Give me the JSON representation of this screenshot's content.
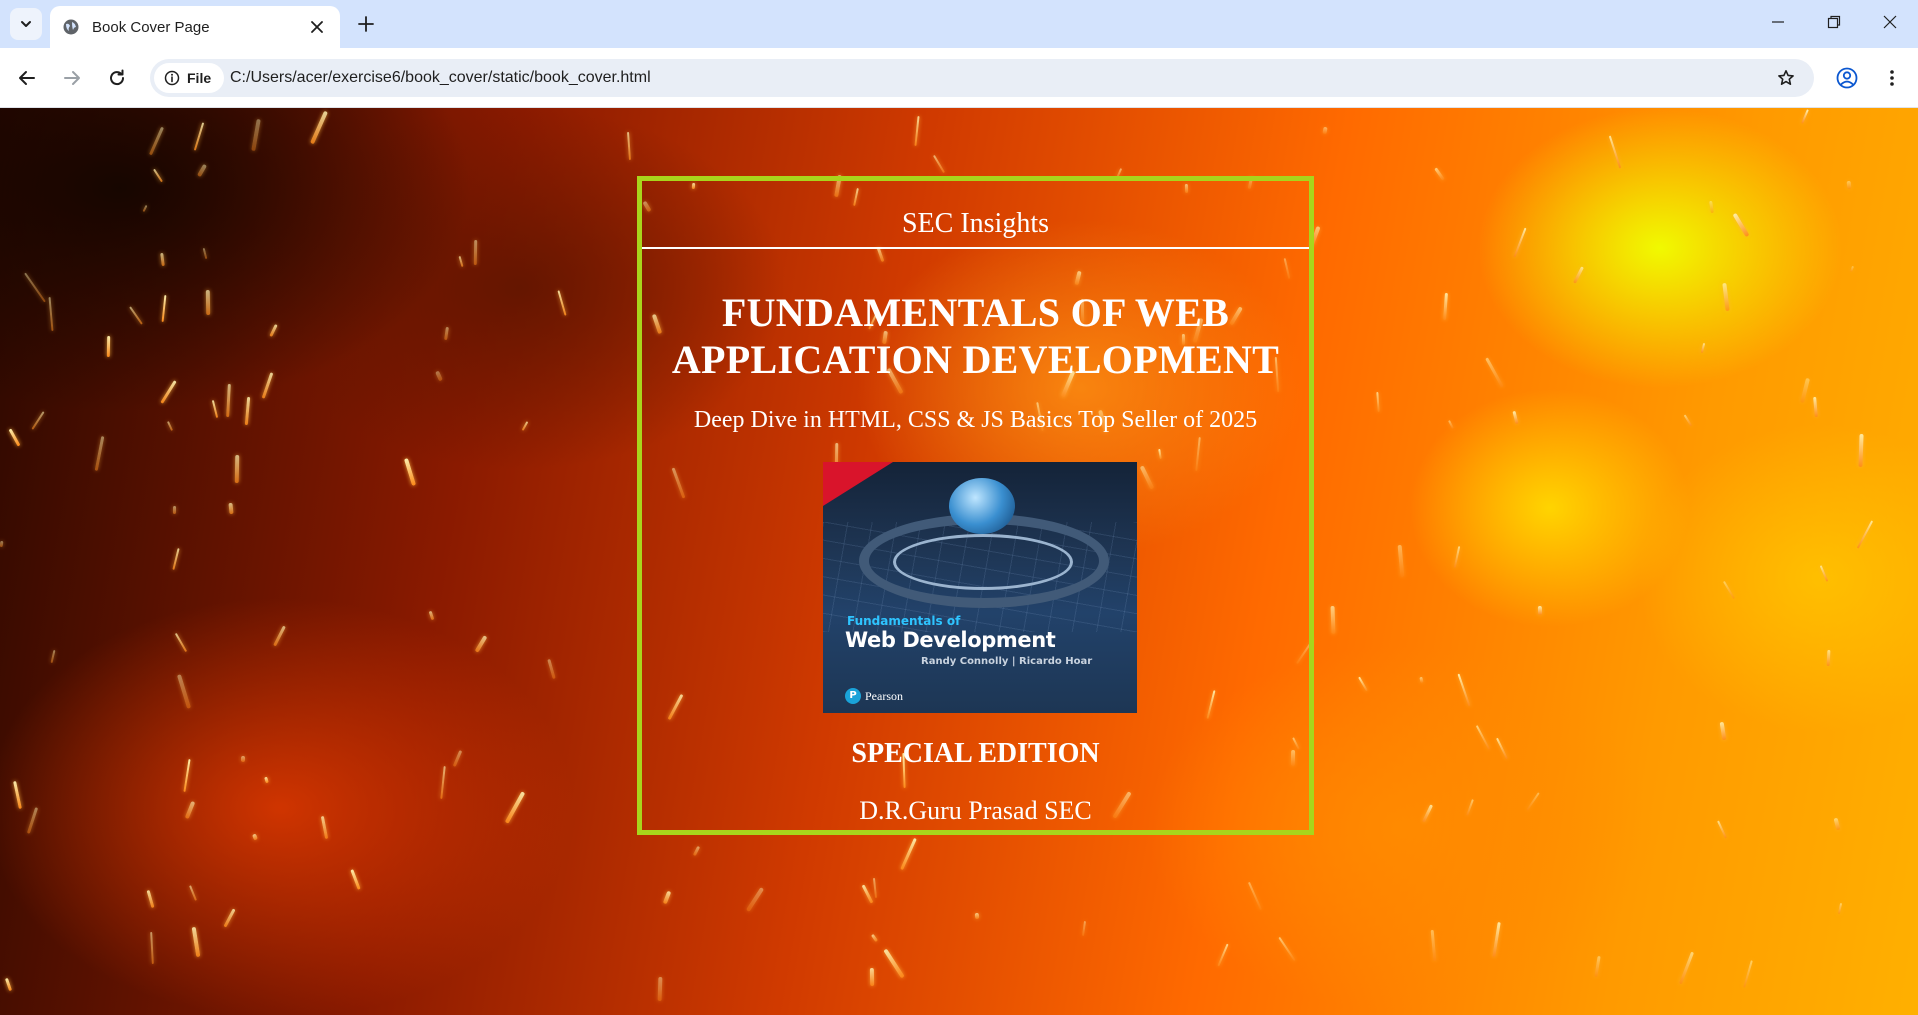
{
  "browser": {
    "tab": {
      "title": "Book Cover Page"
    },
    "address_bar": {
      "site_chip_label": "File",
      "url": "C:/Users/acer/exercise6/book_cover/static/book_cover.html"
    },
    "icons": {
      "tab_search": "chevron-down-icon",
      "favicon": "globe-icon",
      "tab_close": "close-icon",
      "new_tab": "plus-icon",
      "back": "arrow-left-icon",
      "forward": "arrow-right-icon",
      "reload": "reload-icon",
      "site_info": "info-icon",
      "bookmark": "star-icon",
      "profile": "profile-icon",
      "menu": "kebab-menu-icon",
      "minimize": "minimize-icon",
      "restore": "restore-icon",
      "close_window": "close-icon"
    }
  },
  "cover": {
    "border_color": "#a8d51c",
    "series": "SEC Insights",
    "title": "FUNDAMENTALS OF WEB APPLICATION DEVELOPMENT",
    "subtitle": "Deep Dive in HTML, CSS & JS Basics Top Seller of 2025",
    "book_image": {
      "kicker": "Fundamentals of",
      "main_title": "Web Development",
      "authors": "Randy Connolly | Ricardo Hoar",
      "publisher": "Pearson"
    },
    "edition": "SPECIAL EDITION",
    "author": "D.R.Guru Prasad SEC"
  }
}
